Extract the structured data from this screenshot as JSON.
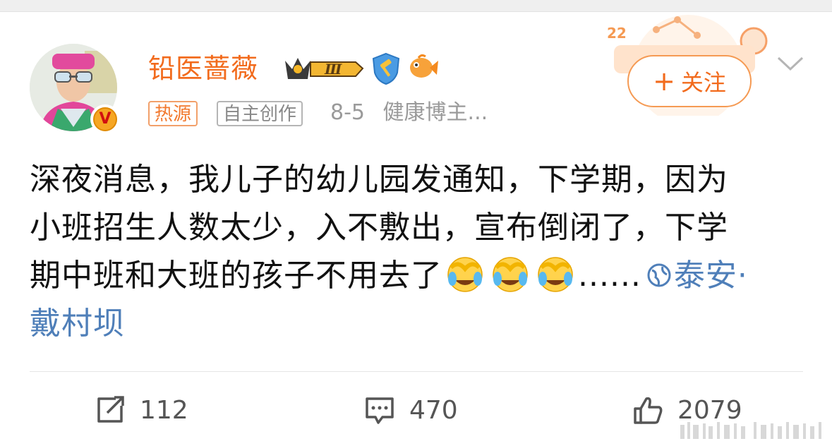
{
  "user": {
    "name": "铅医蔷薇",
    "level_badge": "Ⅲ",
    "verified_mark": "V"
  },
  "tags": {
    "hot": "热源",
    "original": "自主创作"
  },
  "meta": {
    "date": "8-5",
    "category": "健康博主..."
  },
  "follow_button": {
    "plus": "+",
    "label": "关注"
  },
  "post": {
    "line1": "深夜消息，我儿子的幼儿园发通知，下学期，因为",
    "line2": "小班招生人数太少，入不敷出，宣布倒闭了，下学",
    "line3_text": "期中班和大班的孩子不用去了",
    "ellipsis": "......",
    "location": "泰安·",
    "location_cont": "戴村坝"
  },
  "actions": {
    "repost_count": "112",
    "comment_count": "470",
    "like_count": "2079"
  },
  "icons": {
    "repost": "share-icon",
    "comment": "comment-icon",
    "like": "thumbs-up-icon",
    "location": "location-icon",
    "emoji": "laugh-cry-emoji-icon"
  },
  "colors": {
    "accent": "#f26b1d",
    "link": "#4f7fb9",
    "muted": "#9a9a9a"
  }
}
